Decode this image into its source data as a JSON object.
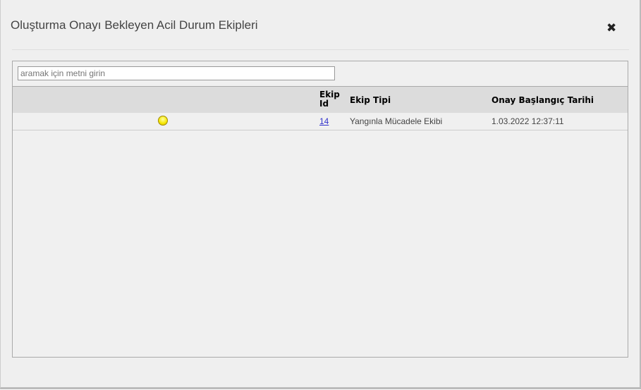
{
  "dialog": {
    "title": "Oluşturma Onayı Bekleyen Acil Durum Ekipleri",
    "close_icon": "close-icon"
  },
  "search": {
    "placeholder": "aramak için metni girin"
  },
  "table": {
    "columns": [
      "Ekip Id",
      "Ekip Tipi",
      "Onay Başlangıç Tarihi"
    ],
    "column_id_line1": "Ekip",
    "column_id_line2": "Id",
    "rows": [
      {
        "status": "yellow",
        "status_icon": "status-light-icon",
        "id": "14",
        "type": "Yangınla Mücadele Ekibi",
        "date": "1.03.2022 12:37:11"
      }
    ]
  }
}
